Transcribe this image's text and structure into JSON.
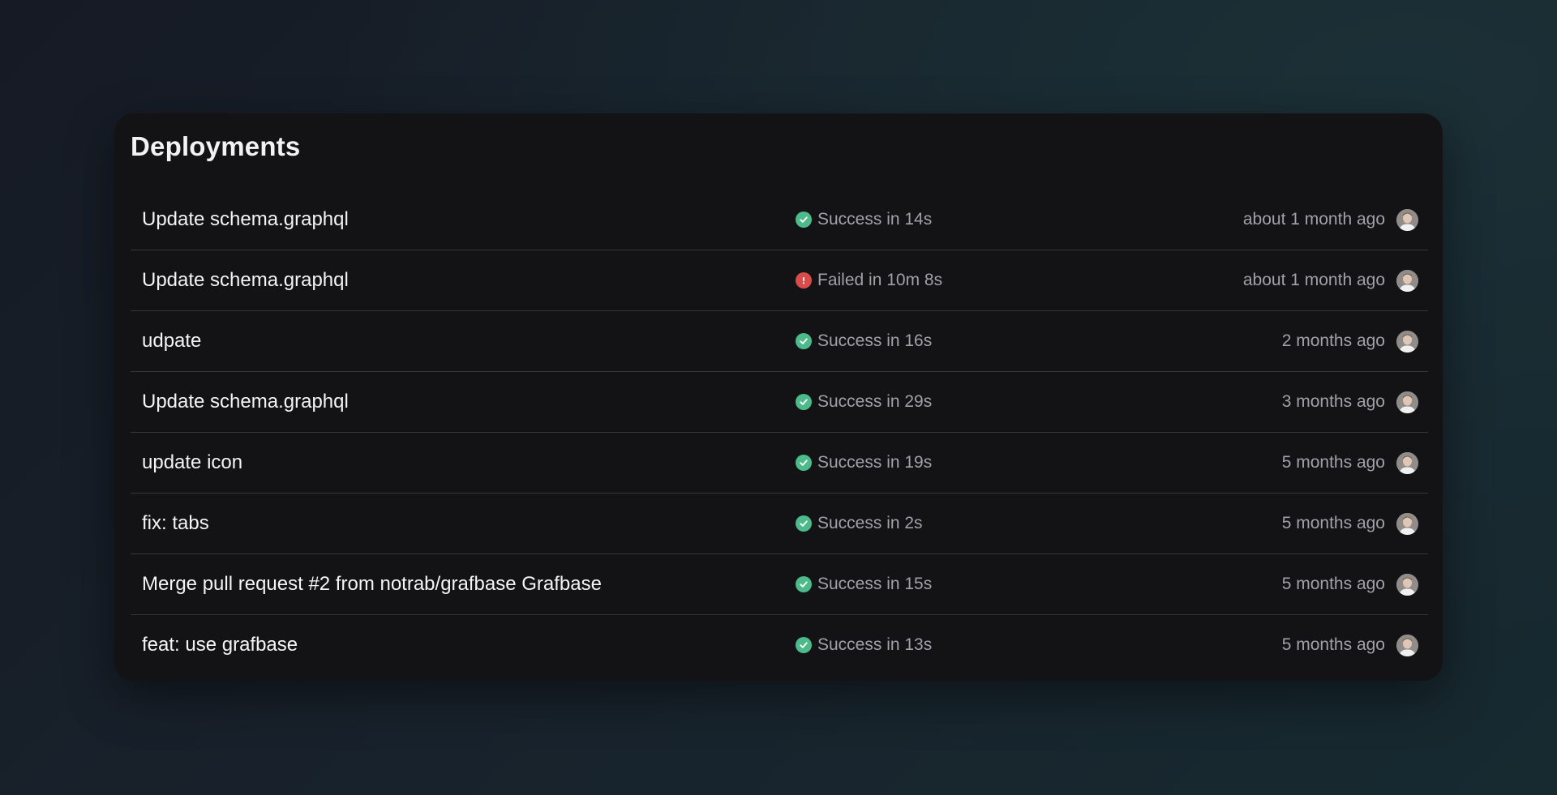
{
  "header": {
    "title": "Deployments"
  },
  "colors": {
    "success": "#4cba8b",
    "failed": "#d94c4c",
    "card_background": "#131315"
  },
  "deployments": [
    {
      "commit": "Update schema.graphql",
      "status": "success",
      "status_icon": "check-circle-icon",
      "status_text": "Success in 14s",
      "time": "about 1 month ago",
      "avatar": "user-avatar"
    },
    {
      "commit": "Update schema.graphql",
      "status": "failed",
      "status_icon": "error-circle-icon",
      "status_text": "Failed in 10m 8s",
      "time": "about 1 month ago",
      "avatar": "user-avatar"
    },
    {
      "commit": "udpate",
      "status": "success",
      "status_icon": "check-circle-icon",
      "status_text": "Success in 16s",
      "time": "2 months ago",
      "avatar": "user-avatar"
    },
    {
      "commit": "Update schema.graphql",
      "status": "success",
      "status_icon": "check-circle-icon",
      "status_text": "Success in 29s",
      "time": "3 months ago",
      "avatar": "user-avatar"
    },
    {
      "commit": "update icon",
      "status": "success",
      "status_icon": "check-circle-icon",
      "status_text": "Success in 19s",
      "time": "5 months ago",
      "avatar": "user-avatar"
    },
    {
      "commit": "fix: tabs",
      "status": "success",
      "status_icon": "check-circle-icon",
      "status_text": "Success in 2s",
      "time": "5 months ago",
      "avatar": "user-avatar"
    },
    {
      "commit": "Merge pull request #2 from notrab/grafbase Grafbase",
      "status": "success",
      "status_icon": "check-circle-icon",
      "status_text": "Success in 15s",
      "time": "5 months ago",
      "avatar": "user-avatar"
    },
    {
      "commit": "feat: use grafbase",
      "status": "success",
      "status_icon": "check-circle-icon",
      "status_text": "Success in 13s",
      "time": "5 months ago",
      "avatar": "user-avatar"
    }
  ]
}
